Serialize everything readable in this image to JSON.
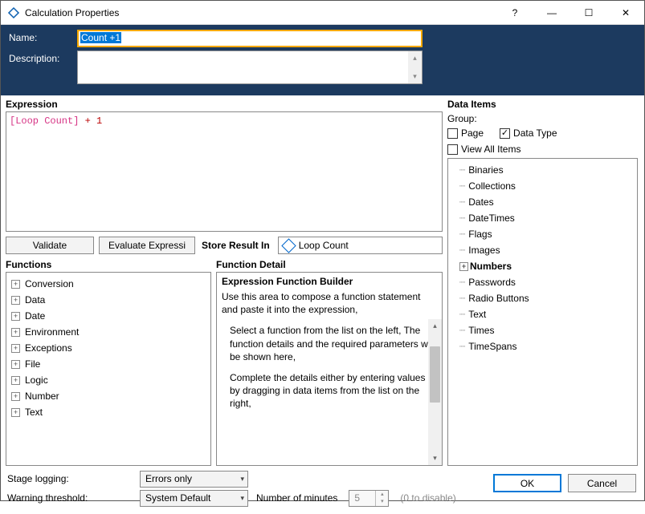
{
  "window": {
    "title": "Calculation Properties",
    "help": "?",
    "min": "—",
    "max": "☐",
    "close": "✕"
  },
  "header": {
    "name_label": "Name:",
    "name_value": "Count +1",
    "desc_label": "Description:",
    "desc_value": ""
  },
  "expression": {
    "label": "Expression",
    "token_bracket": "[Loop Count]",
    "token_rest": " + 1",
    "validate_btn": "Validate",
    "evaluate_btn": "Evaluate Expressi",
    "store_label": "Store Result In",
    "store_value": "Loop Count"
  },
  "functions": {
    "label": "Functions",
    "items": [
      "Conversion",
      "Data",
      "Date",
      "Environment",
      "Exceptions",
      "File",
      "Logic",
      "Number",
      "Text"
    ]
  },
  "detail": {
    "label": "Function Detail",
    "header": "Expression Function Builder",
    "p1": "Use this area to compose a function statement and paste it into the expression,",
    "p2": "Select a function from the list on the left, The function details and the required parameters will be shown here,",
    "p3": "Complete the details either by entering values or by dragging in data items from the list on the right,"
  },
  "dataitems": {
    "label": "Data Items",
    "group_label": "Group:",
    "chk_page": "Page",
    "chk_datatype": "Data Type",
    "chk_viewall": "View All Items",
    "items": [
      {
        "label": "Binaries",
        "bold": false,
        "exp": false
      },
      {
        "label": "Collections",
        "bold": false,
        "exp": false
      },
      {
        "label": "Dates",
        "bold": false,
        "exp": false
      },
      {
        "label": "DateTimes",
        "bold": false,
        "exp": false
      },
      {
        "label": "Flags",
        "bold": false,
        "exp": false
      },
      {
        "label": "Images",
        "bold": false,
        "exp": false
      },
      {
        "label": "Numbers",
        "bold": true,
        "exp": true
      },
      {
        "label": "Passwords",
        "bold": false,
        "exp": false
      },
      {
        "label": "Radio Buttons",
        "bold": false,
        "exp": false
      },
      {
        "label": "Text",
        "bold": false,
        "exp": false
      },
      {
        "label": "Times",
        "bold": false,
        "exp": false
      },
      {
        "label": "TimeSpans",
        "bold": false,
        "exp": false
      }
    ]
  },
  "footer": {
    "stage_label": "Stage logging:",
    "stage_value": "Errors only",
    "warn_label": "Warning threshold:",
    "warn_value": "System Default",
    "minutes_label": "Number of minutes",
    "minutes_value": "5",
    "disable_hint": "(0 to disable)",
    "ok": "OK",
    "cancel": "Cancel"
  }
}
